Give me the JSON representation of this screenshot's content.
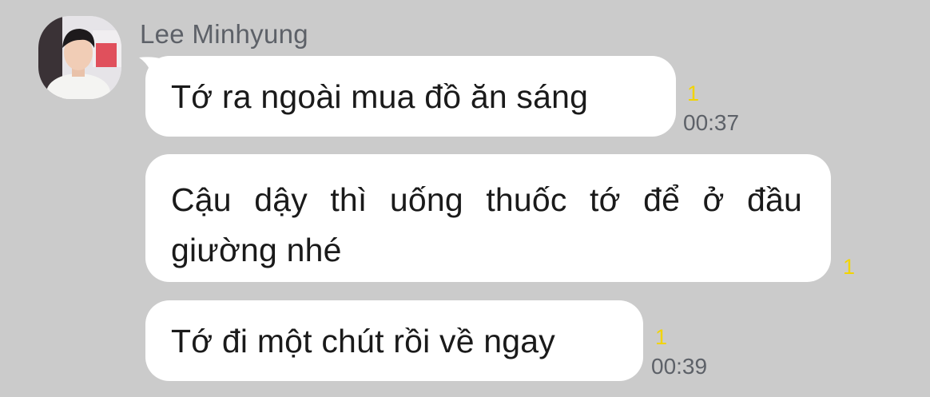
{
  "chat": {
    "sender_name": "Lee Minhyung",
    "avatar_icon": "profile-photo",
    "colors": {
      "background": "#cbcbcb",
      "bubble": "#ffffff",
      "unread": "#f2d400",
      "meta_text": "#5d6168"
    },
    "messages": [
      {
        "text": "Tớ ra ngoài mua đồ ăn sáng",
        "unread": "1",
        "time": "00:37"
      },
      {
        "text": "Cậu dậy thì uống thuốc tớ để ở đầu giường nhé",
        "unread": "1",
        "time": ""
      },
      {
        "text": "Tớ đi một chút rồi về ngay",
        "unread": "1",
        "time": "00:39"
      }
    ]
  }
}
